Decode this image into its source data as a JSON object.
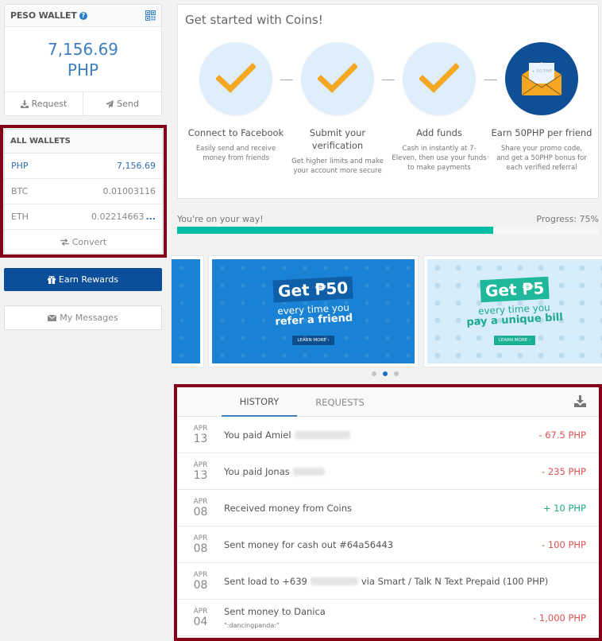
{
  "peso_wallet": {
    "title": "PESO WALLET",
    "help_icon": "question-circle-icon",
    "qr_icon": "qrcode-icon",
    "balance_amount": "7,156.69",
    "balance_currency": "PHP",
    "request_label": "Request",
    "send_label": "Send"
  },
  "all_wallets": {
    "title": "ALL WALLETS",
    "rows": [
      {
        "currency": "PHP",
        "amount": "7,156.69",
        "active": true
      },
      {
        "currency": "BTC",
        "amount": "0.01003116",
        "active": false
      },
      {
        "currency": "ETH",
        "amount": "0.02214663",
        "active": false,
        "more": "..."
      }
    ],
    "convert_label": "Convert"
  },
  "earn_rewards_label": "Earn Rewards",
  "my_messages_label": "My Messages",
  "get_started": {
    "title": "Get started with Coins!",
    "steps": [
      {
        "title": "Connect to Facebook",
        "desc": "Easily send and receive money from friends",
        "done": true
      },
      {
        "title": "Submit your verification",
        "desc": "Get higher limits and make your account more secure",
        "done": true
      },
      {
        "title": "Add funds",
        "desc": "Cash in instantly at 7-Eleven, then use your funds to make payments",
        "done": true
      },
      {
        "title": "Earn 50PHP per friend",
        "desc": "Share your promo code, and get a 50PHP bonus for each verified referral",
        "done": false,
        "envelope_text": "+ 50 PHP"
      }
    ]
  },
  "progress": {
    "message": "You're on your way!",
    "label": "Progress: 75%",
    "value_percent": 75,
    "bar_color": "#00bfa5"
  },
  "banners": [
    {
      "headline": "Get ₱50",
      "line1": "every time you",
      "line2": "refer a friend",
      "cta": "LEARN MORE ›"
    },
    {
      "headline": "Get ₱5",
      "line1": "every time you",
      "line2": "pay a unique bill",
      "cta": "LEARN MORE ›"
    }
  ],
  "carousel": {
    "count": 3,
    "active_index": 1
  },
  "history": {
    "tabs": [
      {
        "label": "HISTORY",
        "active": true
      },
      {
        "label": "REQUESTS",
        "active": false
      }
    ],
    "download_icon": "download-icon",
    "rows": [
      {
        "month": "APR",
        "day": "13",
        "text": "You paid Amiel",
        "redacted": true,
        "suffix": "",
        "sub": "",
        "amount": "- 67.5 PHP",
        "type": "neg"
      },
      {
        "month": "APR",
        "day": "13",
        "text": "You paid Jonas",
        "redacted": true,
        "suffix": "",
        "sub": "",
        "amount": "- 235 PHP",
        "type": "neg"
      },
      {
        "month": "APR",
        "day": "08",
        "text": "Received money from Coins",
        "redacted": false,
        "suffix": "",
        "sub": "",
        "amount": "+ 10 PHP",
        "type": "pos"
      },
      {
        "month": "APR",
        "day": "08",
        "text": "Sent money for cash out #64a56443",
        "redacted": false,
        "suffix": "",
        "sub": "",
        "amount": "- 100 PHP",
        "type": "neg"
      },
      {
        "month": "APR",
        "day": "08",
        "text": "Sent load to +639",
        "redacted": true,
        "suffix": "via Smart / Talk N Text Prepaid (100 PHP)",
        "sub": "",
        "amount": "",
        "type": "neg"
      },
      {
        "month": "APR",
        "day": "04",
        "text": "Sent money to Danica",
        "redacted": false,
        "suffix": "",
        "sub": "\":dancingpanda:\"",
        "amount": "- 1,000 PHP",
        "type": "neg"
      }
    ]
  }
}
